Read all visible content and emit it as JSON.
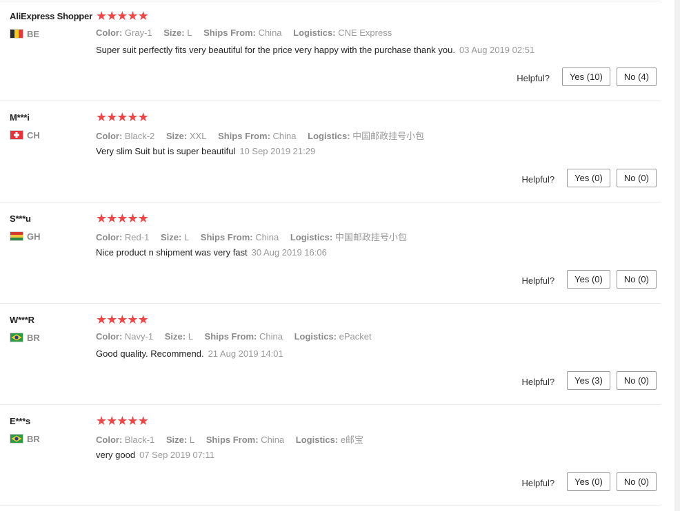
{
  "helpful_label": "Helpful?",
  "labels": {
    "color": "Color:",
    "size": "Size:",
    "ships_from": "Ships From:",
    "logistics": "Logistics:"
  },
  "star_color": "#f04545",
  "reviews": [
    {
      "user": "AliExpress Shopper",
      "country": "BE",
      "rating": 5,
      "color": "Gray-1",
      "size": "L",
      "ships_from": "China",
      "logistics": "CNE Express",
      "text": "Super suit perfectly fits very beautiful for the price very happy with the purchase thank you.",
      "date": "03 Aug 2019 02:51",
      "yes": "Yes (10)",
      "no": "No (4)"
    },
    {
      "user": "M***i",
      "country": "CH",
      "rating": 5,
      "color": "Black-2",
      "size": "XXL",
      "ships_from": "China",
      "logistics": "中国邮政挂号小包",
      "text": "Very slim Suit but is super beautiful",
      "date": "10 Sep 2019 21:29",
      "yes": "Yes (0)",
      "no": "No (0)"
    },
    {
      "user": "S***u",
      "country": "GH",
      "rating": 5,
      "color": "Red-1",
      "size": "L",
      "ships_from": "China",
      "logistics": "中国邮政挂号小包",
      "text": "Nice product n shipment was very fast",
      "date": "30 Aug 2019 16:06",
      "yes": "Yes (0)",
      "no": "No (0)"
    },
    {
      "user": "W***R",
      "country": "BR",
      "rating": 5,
      "color": "Navy-1",
      "size": "L",
      "ships_from": "China",
      "logistics": "ePacket",
      "text": "Good quality. Recommend.",
      "date": "21 Aug 2019 14:01",
      "yes": "Yes (3)",
      "no": "No (0)"
    },
    {
      "user": "E***s",
      "country": "BR",
      "rating": 5,
      "color": "Black-1",
      "size": "L",
      "ships_from": "China",
      "logistics": "e邮宝",
      "text": "very good",
      "date": "07 Sep 2019 07:11",
      "yes": "Yes (0)",
      "no": "No (0)"
    }
  ]
}
